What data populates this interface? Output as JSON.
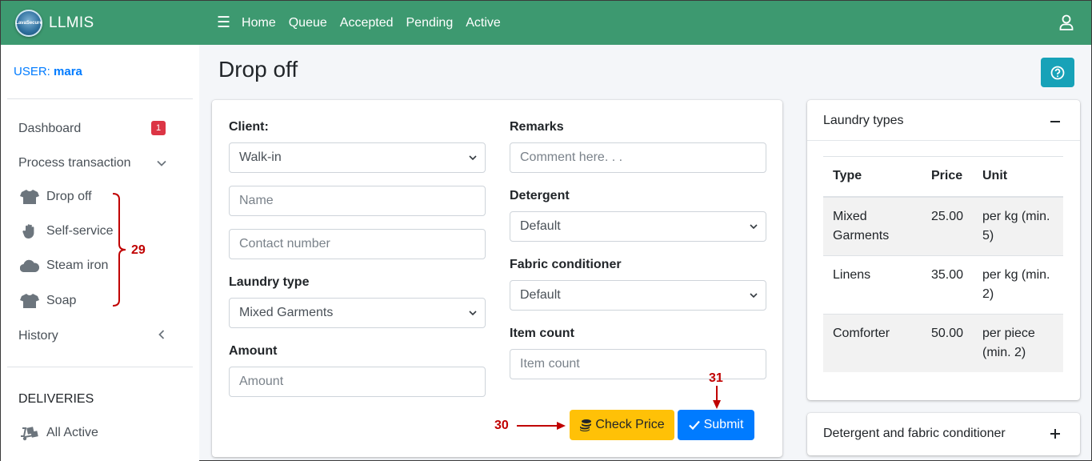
{
  "navbar": {
    "brand": "LLMIS",
    "logo_text": "LavaSecure",
    "links": [
      "Home",
      "Queue",
      "Accepted",
      "Pending",
      "Active"
    ]
  },
  "sidebar": {
    "user_prefix": "USER:",
    "username": "mara",
    "dashboard": "Dashboard",
    "dashboard_badge": "1",
    "process_transaction": "Process transaction",
    "sub_items": [
      "Drop off",
      "Self-service",
      "Steam iron",
      "Soap"
    ],
    "history": "History",
    "deliveries_header": "DELIVERIES",
    "all_active": "All Active"
  },
  "annotations": {
    "bracket_label": "29",
    "check_price_label": "30",
    "submit_label": "31"
  },
  "page": {
    "title": "Drop off"
  },
  "form": {
    "client_label": "Client:",
    "client_value": "Walk-in",
    "name_placeholder": "Name",
    "contact_placeholder": "Contact number",
    "laundry_type_label": "Laundry type",
    "laundry_type_value": "Mixed Garments",
    "amount_label": "Amount",
    "amount_placeholder": "Amount",
    "remarks_label": "Remarks",
    "remarks_placeholder": "Comment here. . .",
    "detergent_label": "Detergent",
    "detergent_value": "Default",
    "fabric_label": "Fabric conditioner",
    "fabric_value": "Default",
    "item_count_label": "Item count",
    "item_count_placeholder": "Item count",
    "check_price_button": "Check Price",
    "submit_button": "Submit"
  },
  "laundry_types": {
    "title": "Laundry types",
    "columns": [
      "Type",
      "Price",
      "Unit"
    ],
    "rows": [
      {
        "type": "Mixed Garments",
        "price": "25.00",
        "unit": "per kg (min. 5)"
      },
      {
        "type": "Linens",
        "price": "35.00",
        "unit": "per kg (min. 2)"
      },
      {
        "type": "Comforter",
        "price": "50.00",
        "unit": "per piece (min. 2)"
      }
    ]
  },
  "detergent_card": {
    "title": "Detergent and fabric conditioner"
  },
  "colors": {
    "navbar": "#3d9970",
    "primary": "#007bff",
    "warning": "#ffc107",
    "info": "#17a2b8",
    "danger": "#dc3545",
    "annotation": "#c00000"
  }
}
